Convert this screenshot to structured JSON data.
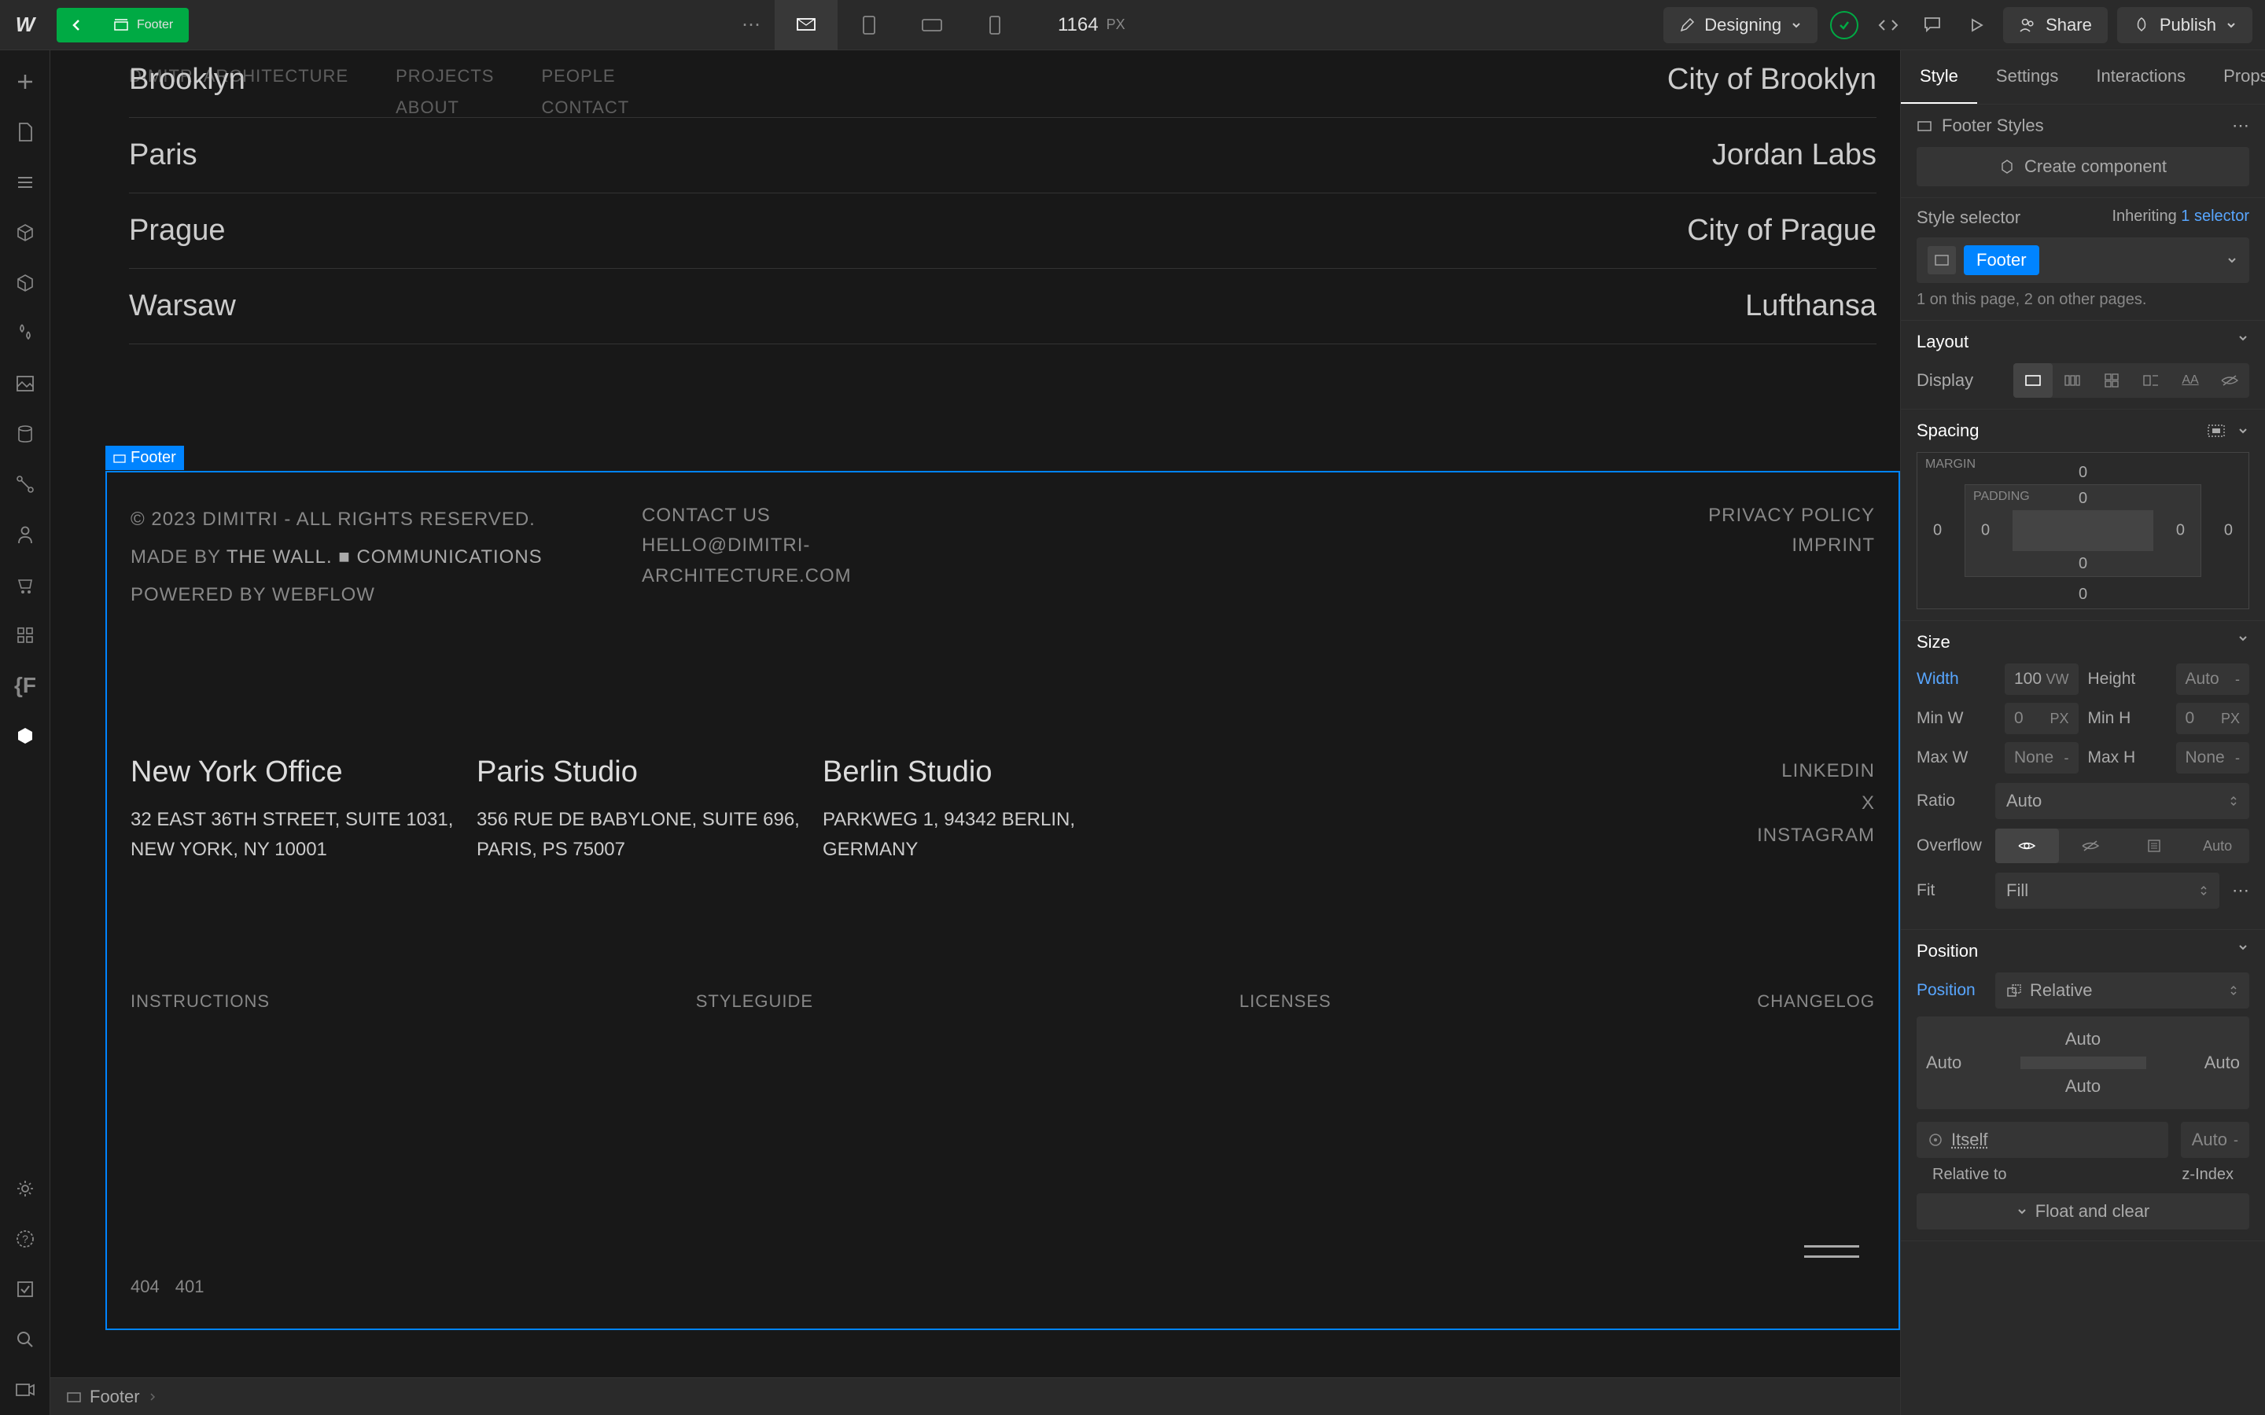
{
  "topbar": {
    "element_badge": "Footer",
    "canvas_width": "1164",
    "canvas_unit": "PX",
    "designing": "Designing",
    "share": "Share",
    "publish": "Publish"
  },
  "canvas": {
    "nav": {
      "brand": "DIMITRI ARCHITECTURE",
      "projects": "PROJECTS",
      "about": "ABOUT",
      "people": "PEOPLE",
      "contact": "CONTACT"
    },
    "cities": [
      {
        "city": "Brooklyn",
        "client": "City of Brooklyn"
      },
      {
        "city": "Paris",
        "client": "Jordan Labs"
      },
      {
        "city": "Prague",
        "client": "City of Prague"
      },
      {
        "city": "Warsaw",
        "client": "Lufthansa"
      }
    ],
    "footer_tag": "Footer",
    "copyright": "© 2023 DIMITRI - ALL RIGHTS RESERVED.",
    "made_by_prefix": "MADE BY ",
    "made_by_link": "THE WALL. ■ COMMUNICATIONS",
    "powered": "POWERED BY WEBFLOW",
    "contact_title": "CONTACT US",
    "contact_email": "HELLO@DIMITRI-ARCHITECTURE.COM",
    "privacy": "PRIVACY POLICY",
    "imprint": "IMPRINT",
    "offices": [
      {
        "title": "New York Office",
        "addr": "32 EAST 36TH STREET, SUITE 1031, NEW YORK, NY 10001"
      },
      {
        "title": "Paris Studio",
        "addr": "356 RUE DE BABYLONE, SUITE 696, PARIS, PS 75007"
      },
      {
        "title": "Berlin Studio",
        "addr": "PARKWEG 1, 94342 BERLIN, GERMANY"
      }
    ],
    "socials": [
      "LINKEDIN",
      "X",
      "INSTAGRAM"
    ],
    "bottom_links": [
      "INSTRUCTIONS",
      "STYLEGUIDE",
      "LICENSES",
      "CHANGELOG"
    ],
    "error_links": [
      "404",
      "401"
    ]
  },
  "breadcrumb": {
    "footer": "Footer"
  },
  "panel": {
    "tabs": {
      "style": "Style",
      "settings": "Settings",
      "interactions": "Interactions",
      "props": "Props"
    },
    "footer_styles": "Footer Styles",
    "create_component": "Create component",
    "style_selector": "Style selector",
    "inheriting_text": "Inheriting ",
    "inheriting_count": "1",
    "inheriting_suffix": " selector",
    "selector_tag": "Footer",
    "selector_note": "1 on this page, 2 on other pages.",
    "layout": {
      "title": "Layout",
      "display_label": "Display"
    },
    "spacing": {
      "title": "Spacing",
      "margin": "MARGIN",
      "padding": "PADDING",
      "zero": "0"
    },
    "size": {
      "title": "Size",
      "width_label": "Width",
      "width_val": "100",
      "width_unit": "VW",
      "height_label": "Height",
      "height_val": "Auto",
      "minw_label": "Min W",
      "minw_val": "0",
      "minw_unit": "PX",
      "minh_label": "Min H",
      "minh_val": "0",
      "minh_unit": "PX",
      "maxw_label": "Max W",
      "maxw_val": "None",
      "maxh_label": "Max H",
      "maxh_val": "None",
      "ratio_label": "Ratio",
      "ratio_val": "Auto",
      "overflow_label": "Overflow",
      "overflow_auto": "Auto",
      "fit_label": "Fit",
      "fit_val": "Fill"
    },
    "position": {
      "title": "Position",
      "label": "Position",
      "value": "Relative",
      "auto": "Auto",
      "itself": "Itself",
      "relative_to": "Relative to",
      "zindex": "z-Index",
      "float_clear": "Float and clear"
    }
  }
}
